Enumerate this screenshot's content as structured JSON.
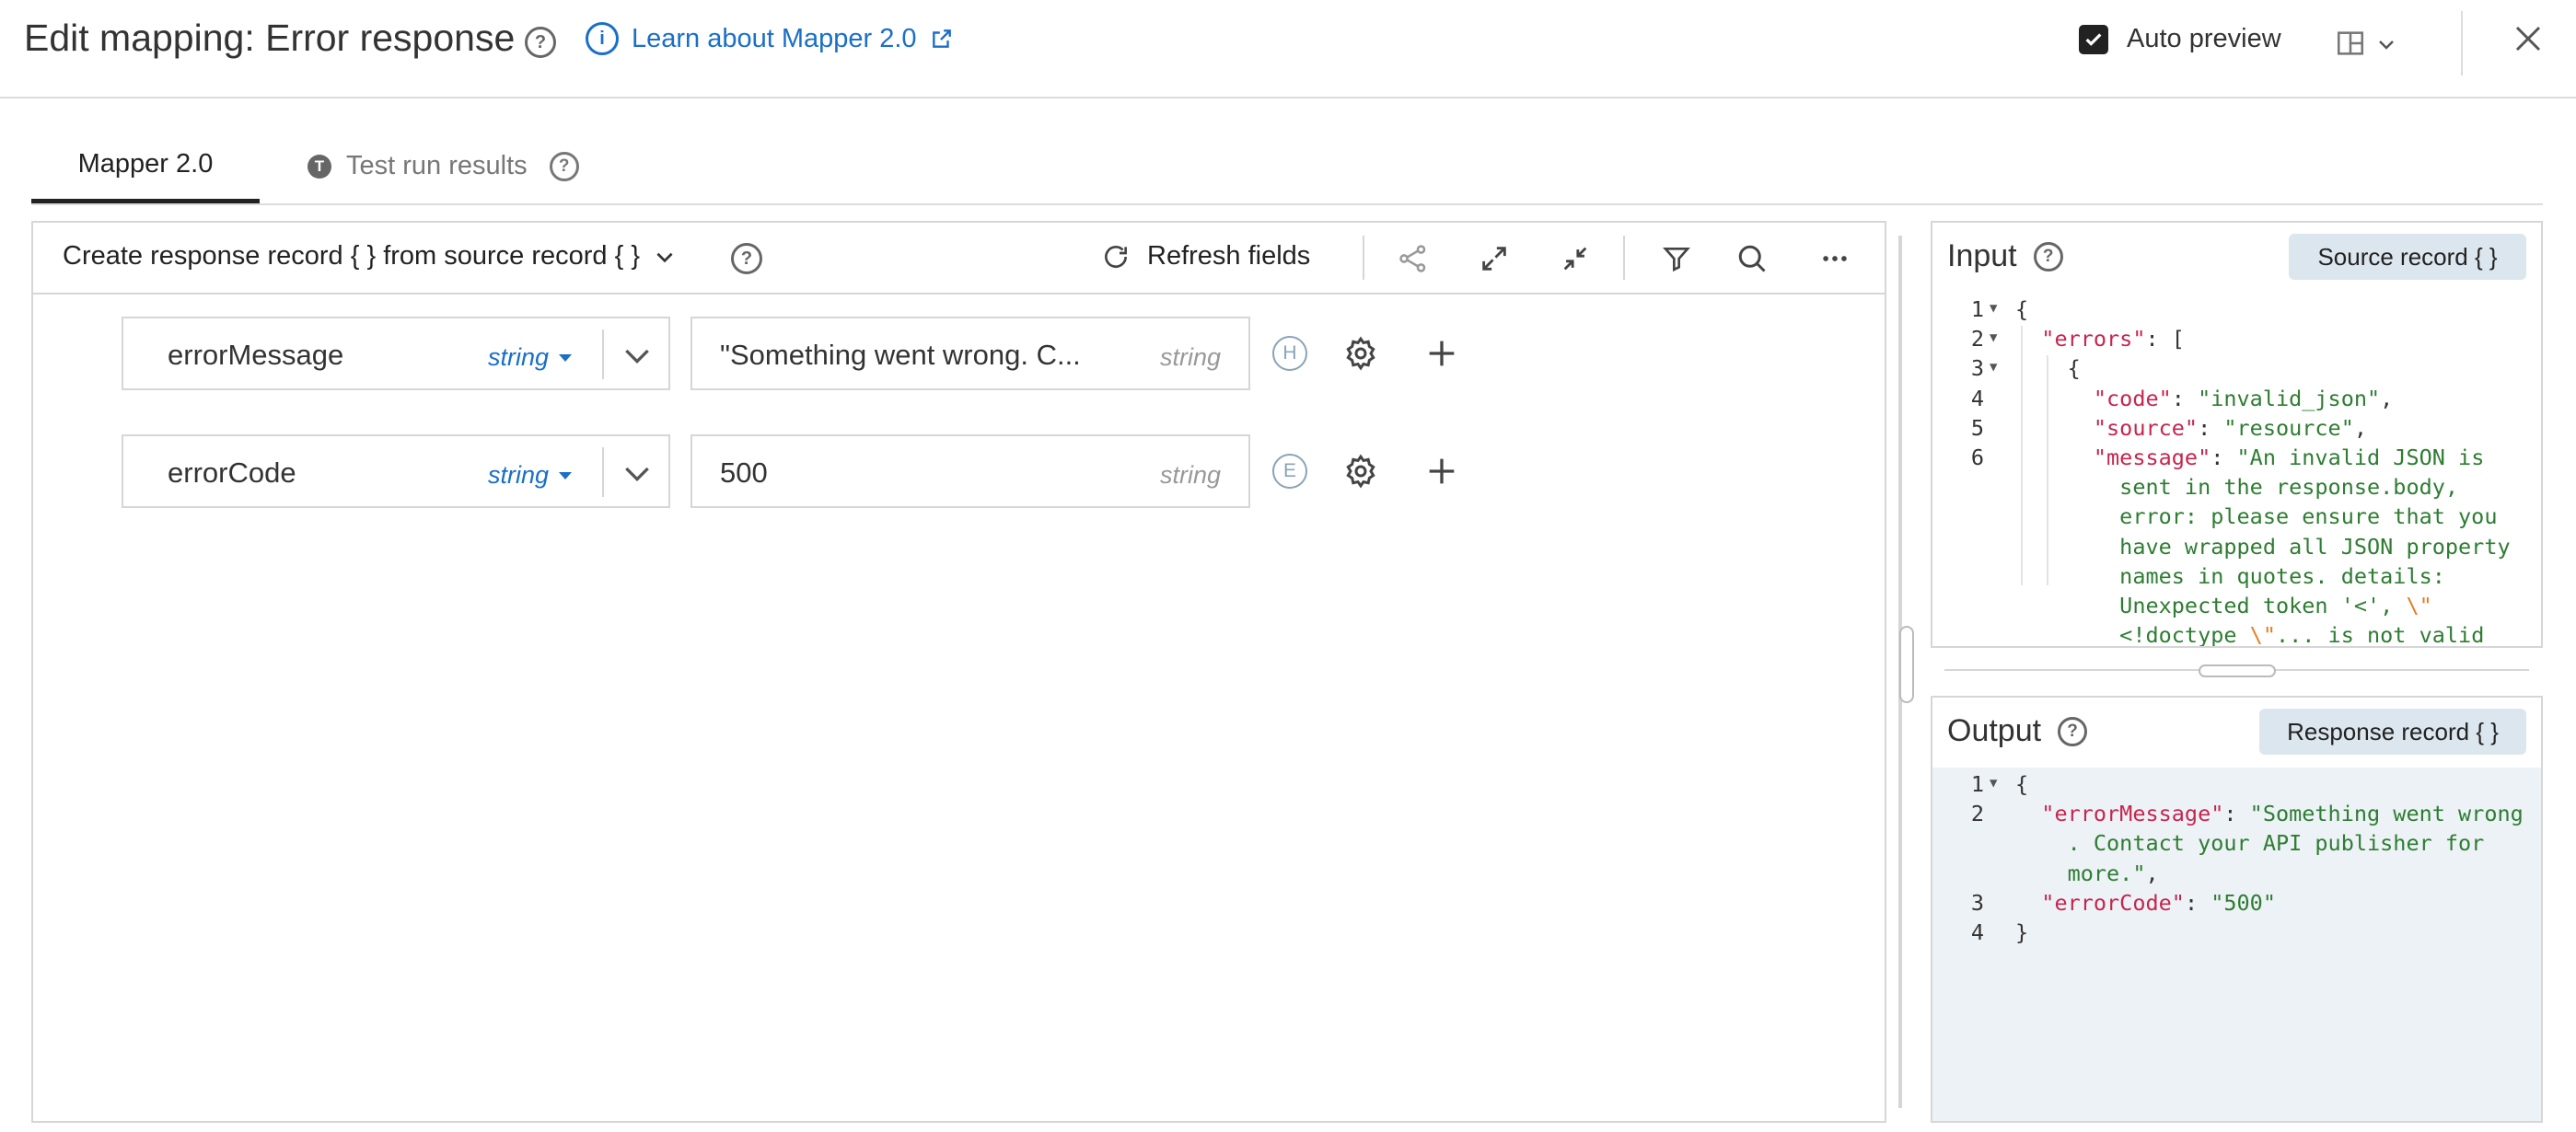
{
  "header": {
    "title": "Edit mapping: Error response",
    "learn_link": "Learn about Mapper 2.0",
    "auto_preview": "Auto preview"
  },
  "tabs": [
    {
      "label": "Mapper 2.0",
      "active": true
    },
    {
      "label": "Test run results",
      "badge": "T"
    }
  ],
  "toolbar": {
    "create_label": "Create response record { } from source record { }",
    "refresh_label": "Refresh fields"
  },
  "mappings": [
    {
      "source_field": "errorMessage",
      "source_type": "string",
      "destination_value": "\"Something went wrong. C...",
      "destination_type": "string",
      "badge": "H"
    },
    {
      "source_field": "errorCode",
      "source_type": "string",
      "destination_value": "500",
      "destination_type": "string",
      "badge": "E"
    }
  ],
  "input_panel": {
    "title": "Input",
    "button": "Source record { }",
    "lines": [
      {
        "n": "1",
        "parts": [
          [
            "p",
            "{"
          ]
        ]
      },
      {
        "n": "2",
        "parts": [
          [
            "p",
            "  "
          ],
          [
            "k",
            "\"errors\""
          ],
          [
            "p",
            ": ["
          ]
        ]
      },
      {
        "n": "3",
        "parts": [
          [
            "p",
            "    {"
          ]
        ]
      },
      {
        "n": "4",
        "parts": [
          [
            "p",
            "      "
          ],
          [
            "k",
            "\"code\""
          ],
          [
            "p",
            ": "
          ],
          [
            "s",
            "\"invalid_json\""
          ],
          [
            "p",
            ","
          ]
        ]
      },
      {
        "n": "5",
        "parts": [
          [
            "p",
            "      "
          ],
          [
            "k",
            "\"source\""
          ],
          [
            "p",
            ": "
          ],
          [
            "s",
            "\"resource\""
          ],
          [
            "p",
            ","
          ]
        ]
      },
      {
        "n": "6",
        "parts": [
          [
            "p",
            "      "
          ],
          [
            "k",
            "\"message\""
          ],
          [
            "p",
            ": "
          ],
          [
            "s",
            "\"An invalid JSON is"
          ]
        ]
      },
      {
        "n": "",
        "parts": [
          [
            "s",
            "        sent in the response.body,"
          ]
        ]
      },
      {
        "n": "",
        "parts": [
          [
            "s",
            "        error: please ensure that you"
          ]
        ]
      },
      {
        "n": "",
        "parts": [
          [
            "s",
            "        have wrapped all JSON property"
          ]
        ]
      },
      {
        "n": "",
        "parts": [
          [
            "s",
            "        names in quotes. details:"
          ]
        ]
      },
      {
        "n": "",
        "parts": [
          [
            "s",
            "        Unexpected token '<', "
          ],
          [
            "o",
            "\\\""
          ]
        ]
      },
      {
        "n": "",
        "parts": [
          [
            "s",
            "        <!doctype "
          ],
          [
            "o",
            "\\\""
          ],
          [
            "s",
            "... is not valid"
          ]
        ]
      }
    ]
  },
  "output_panel": {
    "title": "Output",
    "button": "Response record { }",
    "lines": [
      {
        "n": "1",
        "parts": [
          [
            "p",
            "{"
          ]
        ]
      },
      {
        "n": "2",
        "parts": [
          [
            "p",
            "  "
          ],
          [
            "k",
            "\"errorMessage\""
          ],
          [
            "p",
            ": "
          ],
          [
            "s",
            "\"Something went wrong"
          ]
        ]
      },
      {
        "n": "",
        "parts": [
          [
            "s",
            "    . Contact your API publisher for"
          ]
        ]
      },
      {
        "n": "",
        "parts": [
          [
            "s",
            "    more.\""
          ],
          [
            "p",
            ","
          ]
        ]
      },
      {
        "n": "3",
        "parts": [
          [
            "p",
            "  "
          ],
          [
            "k",
            "\"errorCode\""
          ],
          [
            "p",
            ": "
          ],
          [
            "s",
            "\"500\""
          ]
        ]
      },
      {
        "n": "4",
        "parts": [
          [
            "p",
            "}"
          ]
        ]
      }
    ]
  }
}
